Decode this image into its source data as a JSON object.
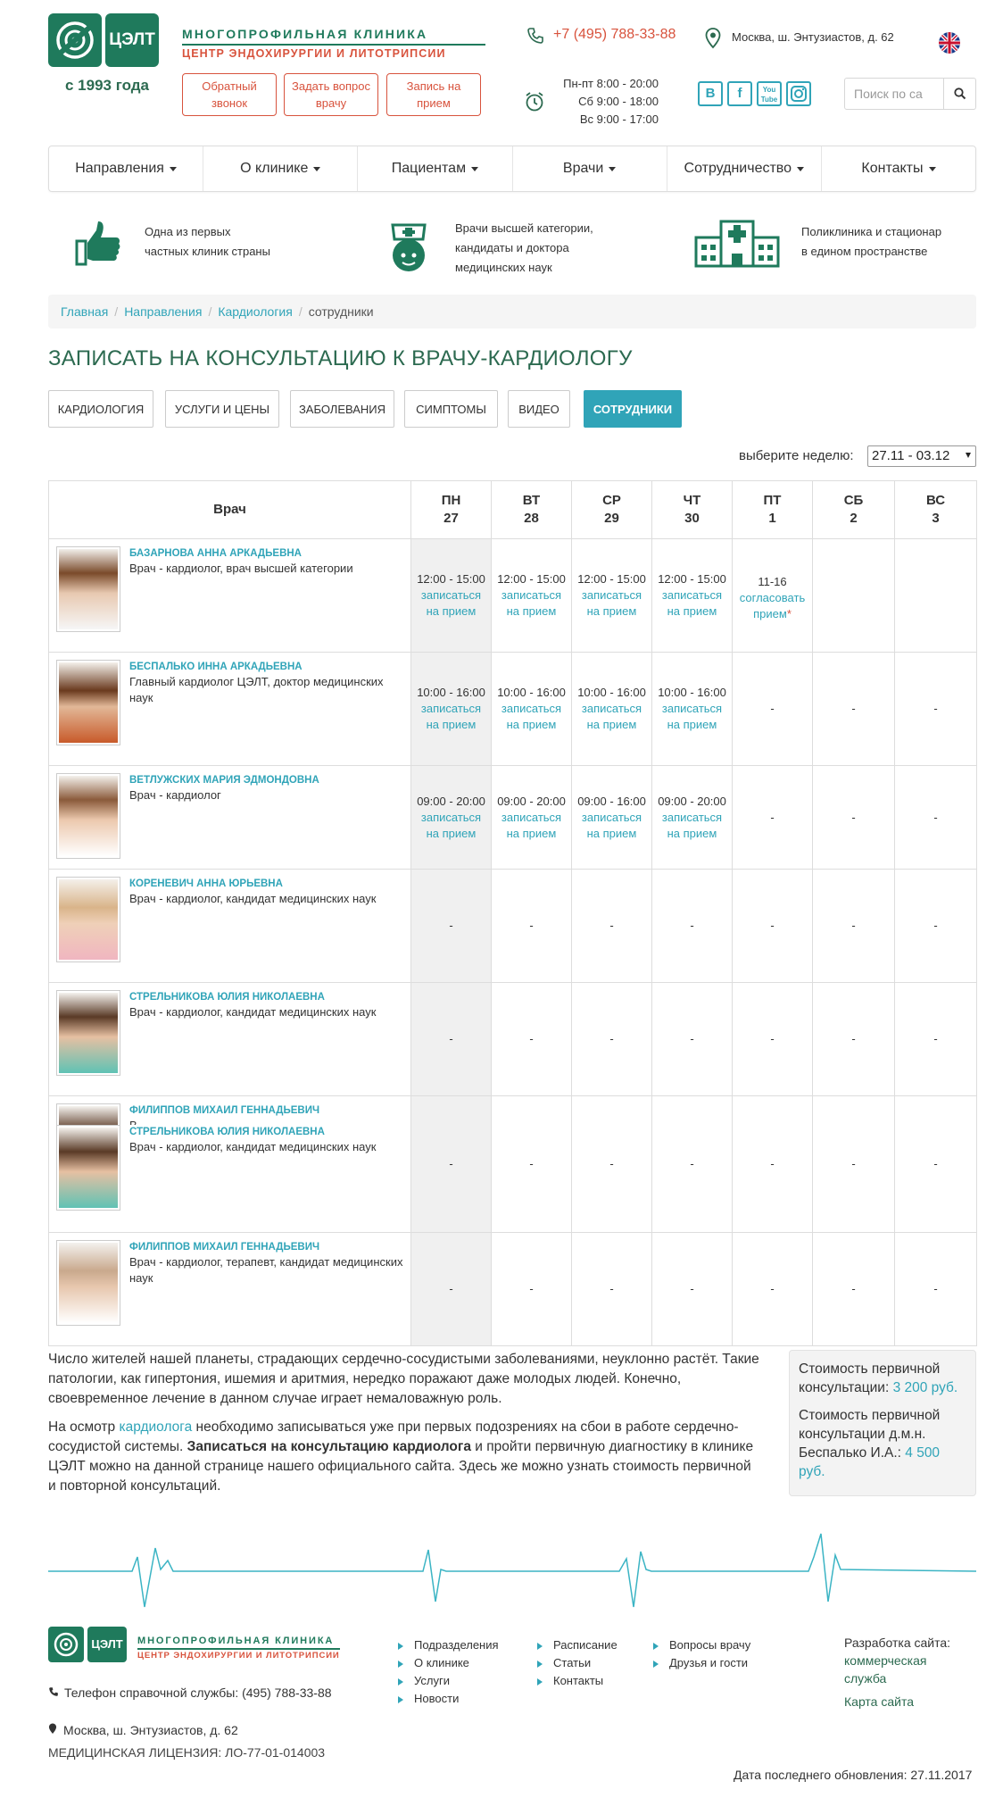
{
  "header": {
    "logo_text": "ЦЭЛТ",
    "since": "с 1993 года",
    "clinic_title": "МНОГОПРОФИЛЬНАЯ КЛИНИКА",
    "clinic_subtitle": "ЦЕНТР ЭНДОХИРУРГИИ И ЛИТОТРИПСИИ",
    "phone": "+7 (495) 788-33-88",
    "address": "Москва, ш. Энтузиастов, д. 62",
    "hours": [
      "Пн-пт 8:00 - 20:00",
      "Сб 9:00 - 18:00",
      "Вс 9:00 - 17:00"
    ],
    "buttons": {
      "callback": "Обратный звонок",
      "ask": "Задать вопрос врачу",
      "appointment": "Запись на прием"
    },
    "social": [
      "В",
      "f",
      "You Tube",
      "ig"
    ],
    "search_placeholder": "Поиск по са"
  },
  "nav": [
    "Направления",
    "О клинике",
    "Пациентам",
    "Врачи",
    "Сотрудничество",
    "Контакты"
  ],
  "features": [
    {
      "line1": "Одна из первых",
      "line2": "частных клиник страны"
    },
    {
      "line1": "Врачи высшей категории,",
      "line2": "кандидаты и доктора",
      "line3": "медицинских наук"
    },
    {
      "line1": "Поликлиника и стационар",
      "line2": "в едином пространстве"
    }
  ],
  "breadcrumb": {
    "home": "Главная",
    "directions": "Направления",
    "cardiology": "Кардиология",
    "current": "сотрудники"
  },
  "page_title": "ЗАПИСАТЬ НА КОНСУЛЬТАЦИЮ К ВРАЧУ-КАРДИОЛОГУ",
  "tabs": [
    "КАРДИОЛОГИЯ",
    "УСЛУГИ И ЦЕНЫ",
    "ЗАБОЛЕВАНИЯ",
    "СИМПТОМЫ",
    "ВИДЕО",
    "СОТРУДНИКИ"
  ],
  "week": {
    "label": "выберите неделю:",
    "value": "27.11 - 03.12"
  },
  "schedule": {
    "doctor_header": "Врач",
    "days": [
      {
        "name": "ПН",
        "date": "27"
      },
      {
        "name": "ВТ",
        "date": "28"
      },
      {
        "name": "СР",
        "date": "29"
      },
      {
        "name": "ЧТ",
        "date": "30"
      },
      {
        "name": "ПТ",
        "date": "1"
      },
      {
        "name": "СБ",
        "date": "2"
      },
      {
        "name": "ВС",
        "date": "3"
      }
    ],
    "book_link": "записаться на прием",
    "agree_link": "согласовать прием",
    "star": "*",
    "dash": "-",
    "rows": [
      {
        "doctors": [
          {
            "name": "БАЗАРНОВА АННА АРКАДЬЕВНА",
            "role": "Врач - кардиолог, врач высшей категории"
          }
        ],
        "slots": [
          "12:00 - 15:00",
          "12:00 - 15:00",
          "12:00 - 15:00",
          "12:00 - 15:00",
          "11-16",
          "",
          ""
        ]
      },
      {
        "doctors": [
          {
            "name": "БЕСПАЛЬКО ИННА АРКАДЬЕВНА",
            "role": "Главный кардиолог ЦЭЛТ, доктор медицинских наук"
          }
        ],
        "slots": [
          "10:00 - 16:00",
          "10:00 - 16:00",
          "10:00 - 16:00",
          "10:00 - 16:00",
          "-",
          "-",
          "-"
        ]
      },
      {
        "doctors": [
          {
            "name": "ВЕТЛУЖСКИХ МАРИЯ ЭДМОНДОВНА",
            "role": "Врач - кардиолог"
          }
        ],
        "slots": [
          "09:00 - 20:00",
          "09:00 - 20:00",
          "09:00 - 16:00",
          "09:00 - 20:00",
          "-",
          "-",
          "-"
        ]
      },
      {
        "doctors": [
          {
            "name": "КОРЕНЕВИЧ АННА ЮРЬЕВНА",
            "role": "Врач - кардиолог, кандидат медицинских наук"
          }
        ],
        "slots": [
          "-",
          "-",
          "-",
          "-",
          "-",
          "-",
          "-"
        ]
      },
      {
        "doctors": [
          {
            "name": "СТРЕЛЬНИКОВА ЮЛИЯ НИКОЛАЕВНА",
            "role": "Врач - кардиолог, кандидат медицинских наук"
          }
        ],
        "slots": [
          "-",
          "-",
          "-",
          "-",
          "-",
          "-",
          "-"
        ]
      },
      {
        "doctors": [
          {
            "name": "ФИЛИППОВ МИХАИЛ ГЕННАДЬЕВИЧ",
            "role": "В"
          },
          {
            "name": "СТРЕЛЬНИКОВА ЮЛИЯ НИКОЛАЕВНА",
            "role": "Врач - кардиолог, кандидат медицинских наук"
          }
        ],
        "slots": [
          "-",
          "-",
          "-",
          "-",
          "-",
          "-",
          "-"
        ]
      },
      {
        "doctors": [
          {
            "name": "ФИЛИППОВ МИХАИЛ ГЕННАДЬЕВИЧ",
            "role": "Врач - кардиолог, терапевт, кандидат медицинских наук"
          }
        ],
        "slots": [
          "-",
          "-",
          "-",
          "-",
          "-",
          "-",
          "-"
        ]
      }
    ]
  },
  "text": {
    "p1": "Число жителей нашей планеты, страдающих сердечно-сосудистыми заболеваниями, неуклонно растёт. Такие патологии, как гипертония, ишемия и аритмия, нередко поражают даже молодых людей. Конечно, своевременное лечение в данном случае играет немаловажную роль.",
    "p2_a": "На осмотр ",
    "p2_link": "кардиолога",
    "p2_b": " необходимо записываться уже при первых подозрениях на сбои в работе сердечно-сосудистой системы. ",
    "p2_bold": "Записаться на консультацию кардиолога",
    "p2_c": " и пройти первичную диагностику в клинике ЦЭЛТ можно на данной странице нашего официального сайта. Здесь же можно узнать стоимость первичной и повторной консультаций."
  },
  "prices": {
    "first_label": "Стоимость первичной консультации: ",
    "first_value": "3 200 руб.",
    "second_label": "Стоимость первичной консультации д.м.н. Беспалько И.А.: ",
    "second_value": "4 500 руб."
  },
  "footer": {
    "logo_text": "ЦЭЛТ",
    "title": "МНОГОПРОФИЛЬНАЯ КЛИНИКА",
    "subtitle": "ЦЕНТР ЭНДОХИРУРГИИ И ЛИТОТРИПСИИ",
    "phone_label": "Телефон справочной службы: (495) 788-33-88",
    "address": "Москва, ш. Энтузиастов, д. 62",
    "license": "МЕДИЦИНСКАЯ ЛИЦЕНЗИЯ: ЛО-77-01-014003",
    "links_col1": [
      "Подразделения",
      "О клинике",
      "Услуги",
      "Новости"
    ],
    "links_col2": [
      "Расписание",
      "Статьи",
      "Контакты"
    ],
    "links_col3": [
      "Вопросы врачу",
      "Друзья и гости"
    ],
    "dev_label": "Разработка сайта:",
    "dev_link": "коммерческая служба",
    "sitemap": "Карта сайта",
    "updated": "Дата последнего обновления: 27.11.2017"
  },
  "colors": {
    "brand_green": "#1f7a5c",
    "accent_red": "#d8533d",
    "link_teal": "#30a4b8"
  }
}
